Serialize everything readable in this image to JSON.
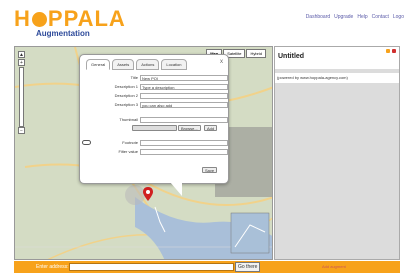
{
  "header": {
    "logo_a": "H",
    "logo_b": "PPALA",
    "subtitle": "Augmentation",
    "nav": [
      "Dashboard",
      "Upgrade",
      "Help",
      "Contact",
      "Logo"
    ]
  },
  "map": {
    "types": [
      "Map",
      "Satellite",
      "Hybrid"
    ]
  },
  "popup": {
    "tabs": [
      "General",
      "Assets",
      "Actions",
      "Location"
    ],
    "close": "x",
    "fields": [
      {
        "label": "Title",
        "value": "New POI"
      },
      {
        "label": "Description 1",
        "value": "Type a description"
      },
      {
        "label": "Description 2",
        "value": ""
      },
      {
        "label": "Description 3",
        "value": "you can also add"
      }
    ],
    "thumbnail_label": "Thumbnail",
    "browse_label": "Browse...",
    "add_label": "Add",
    "footnote_label": "Footnote",
    "filter_label": "Filter value",
    "save_label": "Save"
  },
  "panel": {
    "title": "Untitled",
    "powered": "(powered by www.hoppala-agency.com)"
  },
  "bottom": {
    "enter_address": "Enter address:",
    "go_label": "Go there",
    "add_suggestion": "Add augment"
  },
  "colors": {
    "accent": "#f7a21b",
    "brand_blue": "#2d4a9a"
  }
}
